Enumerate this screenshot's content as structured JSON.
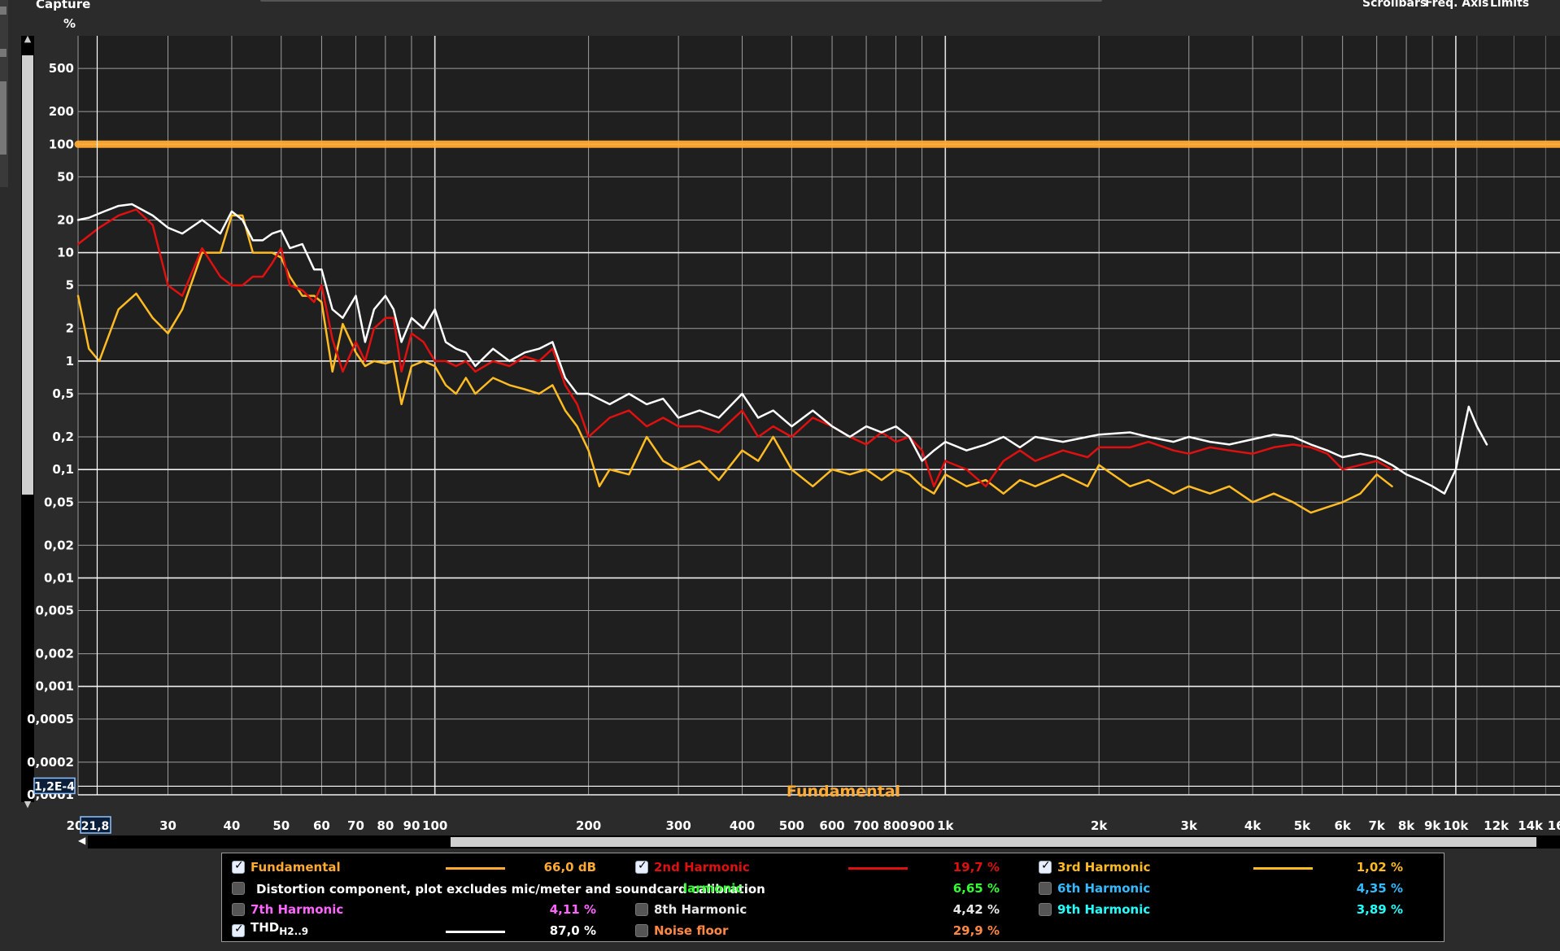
{
  "header": {
    "capture_label": "Capture",
    "y_unit": "%",
    "menu": [
      "Scrollbars",
      "Freq. Axis",
      "Limits"
    ]
  },
  "colors": {
    "background": "#1f1f1f",
    "grid": "#9e9e9e",
    "fundamental": "#ffaa33",
    "h2": "#e01010",
    "h3": "#ffbb22",
    "thd": "#ffffff",
    "h4": "#33ff33",
    "h6": "#33bbff",
    "h7": "#ff66ff",
    "h9": "#22ffff",
    "noise": "#ff8844"
  },
  "chart_data": {
    "type": "line",
    "x_scale": "log",
    "y_scale": "log",
    "xlim": [
      20,
      16000
    ],
    "ylim": [
      0.0001,
      1000
    ],
    "grid": true,
    "cursor_x_label": "21,8",
    "cursor_y_label": "1,2E-4",
    "annotation": "Fundamental",
    "x_ticks": [
      {
        "v": 20,
        "label": "20"
      },
      {
        "v": 30,
        "label": "30"
      },
      {
        "v": 40,
        "label": "40"
      },
      {
        "v": 50,
        "label": "50"
      },
      {
        "v": 60,
        "label": "60"
      },
      {
        "v": 70,
        "label": "70"
      },
      {
        "v": 80,
        "label": "80"
      },
      {
        "v": 90,
        "label": "90"
      },
      {
        "v": 100,
        "label": "100"
      },
      {
        "v": 200,
        "label": "200"
      },
      {
        "v": 300,
        "label": "300"
      },
      {
        "v": 400,
        "label": "400"
      },
      {
        "v": 500,
        "label": "500"
      },
      {
        "v": 600,
        "label": "600"
      },
      {
        "v": 700,
        "label": "700"
      },
      {
        "v": 800,
        "label": "800"
      },
      {
        "v": 900,
        "label": "900"
      },
      {
        "v": 1000,
        "label": "1k"
      },
      {
        "v": 2000,
        "label": "2k"
      },
      {
        "v": 3000,
        "label": "3k"
      },
      {
        "v": 4000,
        "label": "4k"
      },
      {
        "v": 5000,
        "label": "5k"
      },
      {
        "v": 6000,
        "label": "6k"
      },
      {
        "v": 7000,
        "label": "7k"
      },
      {
        "v": 8000,
        "label": "8k"
      },
      {
        "v": 9000,
        "label": "9k"
      },
      {
        "v": 10000,
        "label": "10k"
      },
      {
        "v": 12000,
        "label": "12k"
      },
      {
        "v": 14000,
        "label": "14k"
      },
      {
        "v": 16000,
        "label": "16"
      }
    ],
    "y_ticks": [
      {
        "v": 500,
        "label": "500"
      },
      {
        "v": 200,
        "label": "200"
      },
      {
        "v": 100,
        "label": "100"
      },
      {
        "v": 50,
        "label": "50"
      },
      {
        "v": 20,
        "label": "20"
      },
      {
        "v": 10,
        "label": "10"
      },
      {
        "v": 5,
        "label": "5"
      },
      {
        "v": 2,
        "label": "2"
      },
      {
        "v": 1,
        "label": "1"
      },
      {
        "v": 0.5,
        "label": "0,5"
      },
      {
        "v": 0.2,
        "label": "0,2"
      },
      {
        "v": 0.1,
        "label": "0,1"
      },
      {
        "v": 0.05,
        "label": "0,05"
      },
      {
        "v": 0.02,
        "label": "0,02"
      },
      {
        "v": 0.01,
        "label": "0,01"
      },
      {
        "v": 0.005,
        "label": "0,005"
      },
      {
        "v": 0.002,
        "label": "0,002"
      },
      {
        "v": 0.001,
        "label": "0,001"
      },
      {
        "v": 0.0005,
        "label": "0,0005"
      },
      {
        "v": 0.0002,
        "label": "0,0002"
      },
      {
        "v": 0.0001,
        "label": "0,0001"
      }
    ],
    "series": [
      {
        "key": "fundamental",
        "name": "Fundamental",
        "color": "#ffaa33",
        "width": 9,
        "x": [
          20,
          16000
        ],
        "y": [
          100,
          100
        ]
      },
      {
        "key": "thd",
        "name": "THD H2..9",
        "color": "#ffffff",
        "width": 2.5,
        "x": [
          20,
          21,
          22.5,
          24,
          25.5,
          28,
          30,
          32,
          35,
          38,
          40,
          42,
          44,
          46,
          48,
          50,
          52,
          55,
          58,
          60,
          63,
          66,
          70,
          73,
          76,
          80,
          83,
          86,
          90,
          95,
          100,
          105,
          110,
          115,
          120,
          130,
          140,
          150,
          160,
          170,
          180,
          190,
          200,
          220,
          240,
          260,
          280,
          300,
          330,
          360,
          400,
          430,
          460,
          500,
          550,
          600,
          650,
          700,
          750,
          800,
          850,
          900,
          950,
          1000,
          1100,
          1200,
          1300,
          1400,
          1500,
          1700,
          1900,
          2000,
          2300,
          2500,
          2800,
          3000,
          3300,
          3600,
          4000,
          4400,
          4800,
          5200,
          5600,
          6000,
          6500,
          7000,
          7500,
          8000,
          8500,
          9000,
          9500,
          10000,
          10300,
          10600,
          11000,
          11500
        ],
        "y": [
          20,
          21,
          24,
          27,
          28,
          22,
          17,
          15,
          20,
          15,
          24,
          20,
          13,
          13,
          15,
          16,
          11,
          12,
          7,
          7,
          3,
          2.5,
          4,
          1.5,
          3,
          4,
          3,
          1.5,
          2.5,
          2,
          3,
          1.5,
          1.3,
          1.2,
          0.9,
          1.3,
          1.0,
          1.2,
          1.3,
          1.5,
          0.7,
          0.5,
          0.5,
          0.4,
          0.5,
          0.4,
          0.45,
          0.3,
          0.35,
          0.3,
          0.5,
          0.3,
          0.35,
          0.25,
          0.35,
          0.25,
          0.2,
          0.25,
          0.22,
          0.25,
          0.2,
          0.12,
          0.15,
          0.18,
          0.15,
          0.17,
          0.2,
          0.16,
          0.2,
          0.18,
          0.2,
          0.21,
          0.22,
          0.2,
          0.18,
          0.2,
          0.18,
          0.17,
          0.19,
          0.21,
          0.2,
          0.17,
          0.15,
          0.13,
          0.14,
          0.13,
          0.11,
          0.09,
          0.08,
          0.07,
          0.06,
          0.1,
          0.2,
          0.38,
          0.25,
          0.17
        ]
      },
      {
        "key": "h2",
        "name": "2nd Harmonic",
        "color": "#e01010",
        "width": 2.5,
        "x": [
          20,
          22,
          24,
          26,
          28,
          30,
          32,
          35,
          38,
          40,
          42,
          44,
          46,
          48,
          50,
          52,
          55,
          58,
          60,
          63,
          66,
          70,
          73,
          76,
          80,
          83,
          86,
          90,
          95,
          100,
          105,
          110,
          115,
          120,
          130,
          140,
          150,
          160,
          170,
          180,
          190,
          200,
          220,
          240,
          260,
          280,
          300,
          330,
          360,
          400,
          430,
          460,
          500,
          550,
          600,
          650,
          700,
          750,
          800,
          850,
          900,
          950,
          1000,
          1100,
          1200,
          1300,
          1400,
          1500,
          1700,
          1900,
          2000,
          2300,
          2500,
          2800,
          3000,
          3300,
          3600,
          4000,
          4400,
          4800,
          5200,
          5600,
          6000,
          6500,
          7000,
          7500
        ],
        "y": [
          12,
          17,
          22,
          25,
          18,
          5,
          4,
          11,
          6,
          5,
          5,
          6,
          6,
          8,
          11,
          5,
          4.5,
          3.5,
          5,
          1.6,
          0.8,
          1.5,
          1.0,
          2,
          2.5,
          2.5,
          0.8,
          1.8,
          1.5,
          1.0,
          1.0,
          0.9,
          1.0,
          0.8,
          1.0,
          0.9,
          1.1,
          1.0,
          1.3,
          0.6,
          0.4,
          0.2,
          0.3,
          0.35,
          0.25,
          0.3,
          0.25,
          0.25,
          0.22,
          0.35,
          0.2,
          0.25,
          0.2,
          0.3,
          0.25,
          0.2,
          0.17,
          0.22,
          0.18,
          0.2,
          0.15,
          0.07,
          0.12,
          0.1,
          0.07,
          0.12,
          0.15,
          0.12,
          0.15,
          0.13,
          0.16,
          0.16,
          0.18,
          0.15,
          0.14,
          0.16,
          0.15,
          0.14,
          0.16,
          0.17,
          0.16,
          0.14,
          0.1,
          0.11,
          0.12,
          0.1
        ]
      },
      {
        "key": "h3",
        "name": "3rd Harmonic",
        "color": "#ffbb22",
        "width": 2.5,
        "x": [
          20,
          21,
          22,
          24,
          26,
          28,
          30,
          32,
          35,
          38,
          40,
          42,
          44,
          46,
          48,
          50,
          52,
          55,
          58,
          60,
          63,
          66,
          70,
          73,
          76,
          80,
          83,
          86,
          90,
          95,
          100,
          105,
          110,
          115,
          120,
          130,
          140,
          150,
          160,
          170,
          180,
          190,
          200,
          210,
          220,
          240,
          260,
          280,
          300,
          330,
          360,
          400,
          430,
          460,
          500,
          550,
          600,
          650,
          700,
          750,
          800,
          850,
          900,
          950,
          1000,
          1100,
          1200,
          1300,
          1400,
          1500,
          1700,
          1900,
          2000,
          2300,
          2500,
          2800,
          3000,
          3300,
          3600,
          4000,
          4400,
          4800,
          5200,
          5600,
          6000,
          6500,
          7000,
          7500
        ],
        "y": [
          4,
          1.3,
          1.0,
          3,
          4.2,
          2.5,
          1.8,
          3,
          10,
          10,
          22,
          22,
          10,
          10,
          10,
          9,
          6,
          4,
          4,
          3.5,
          0.8,
          2.2,
          1.2,
          0.9,
          1.0,
          0.95,
          1.0,
          0.4,
          0.9,
          1.0,
          0.9,
          0.6,
          0.5,
          0.7,
          0.5,
          0.7,
          0.6,
          0.55,
          0.5,
          0.6,
          0.35,
          0.25,
          0.15,
          0.07,
          0.1,
          0.09,
          0.2,
          0.12,
          0.1,
          0.12,
          0.08,
          0.15,
          0.12,
          0.2,
          0.1,
          0.07,
          0.1,
          0.09,
          0.1,
          0.08,
          0.1,
          0.09,
          0.07,
          0.06,
          0.09,
          0.07,
          0.08,
          0.06,
          0.08,
          0.07,
          0.09,
          0.07,
          0.11,
          0.07,
          0.08,
          0.06,
          0.07,
          0.06,
          0.07,
          0.05,
          0.06,
          0.05,
          0.04,
          0.045,
          0.05,
          0.06,
          0.09,
          0.07
        ]
      }
    ]
  },
  "legend": {
    "fundamental": {
      "label": "Fundamental",
      "value": "66,0 dB",
      "checked": true
    },
    "h2": {
      "label": "2nd Harmonic",
      "value": "19,7 %",
      "checked": true
    },
    "h3": {
      "label": "3rd Harmonic",
      "value": "1,02 %",
      "checked": true
    },
    "tooltip": "Distortion component, plot excludes mic/meter and soundcard calibration",
    "h4_partial": "larmonic",
    "h4_value": "6,65 %",
    "h6": {
      "label": "6th Harmonic",
      "value": "4,35 %",
      "checked": false
    },
    "h7": {
      "label": "7th Harmonic",
      "value": "4,11 %",
      "checked": false
    },
    "h8": {
      "label": "8th Harmonic",
      "value": "4,42 %",
      "checked": false
    },
    "h9": {
      "label": "9th Harmonic",
      "value": "3,89 %",
      "checked": false
    },
    "thd": {
      "label": "THD",
      "sub": "H2..9",
      "value": "87,0 %",
      "checked": true
    },
    "noise": {
      "label": "Noise floor",
      "value": "29,9 %",
      "checked": false
    }
  }
}
